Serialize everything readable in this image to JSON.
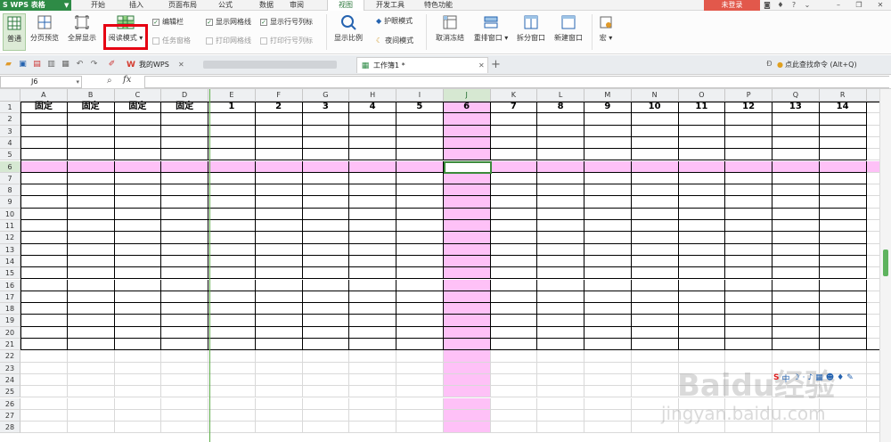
{
  "app": {
    "name": "WPS 表格"
  },
  "menu": {
    "tabs": [
      "开始",
      "插入",
      "页面布局",
      "公式",
      "数据",
      "审阅",
      "视图",
      "开发工具",
      "特色功能"
    ],
    "active": "视图"
  },
  "account": {
    "login_label": "未登录"
  },
  "ribbon": {
    "normal": "普通",
    "page_preview": "分页预览",
    "fullscreen": "全屏显示",
    "reading_mode": "阅读模式",
    "edit_bar": "编辑栏",
    "task_pane": "任务窗格",
    "show_gridlines": "显示网格线",
    "print_gridlines": "打印网格线",
    "show_row_col_headers": "显示行号列标",
    "print_row_col_headers": "打印行号列标",
    "zoom": "显示比例",
    "eye_mode": "护眼模式",
    "night_mode": "夜间模式",
    "unfreeze": "取消冻结",
    "arrange": "重排窗口",
    "split": "拆分窗口",
    "new_window": "新建窗口",
    "macro": "宏"
  },
  "tabs": {
    "wps": "我的WPS",
    "workbook": "工作簿1 *",
    "search": "点此查找命令 (Alt+Q)"
  },
  "formula_bar": {
    "cell_ref": "J6",
    "fx": "fx",
    "value": ""
  },
  "sheet": {
    "columns": [
      "A",
      "B",
      "C",
      "D",
      "E",
      "F",
      "G",
      "H",
      "I",
      "J",
      "K",
      "L",
      "M",
      "N",
      "O",
      "P",
      "Q",
      "R"
    ],
    "header_row": [
      "固定",
      "固定",
      "固定",
      "固定",
      "1",
      "2",
      "3",
      "4",
      "5",
      "6",
      "7",
      "8",
      "9",
      "10",
      "11",
      "12",
      "13",
      "14"
    ],
    "row_count": 28,
    "selected_col": "J",
    "selected_row": 6,
    "highlight_color": "#fec1f7",
    "accent_color": "#2e8b46"
  },
  "watermark": {
    "text": "Baidu经验",
    "sub": "jingyan.baidu.com"
  }
}
